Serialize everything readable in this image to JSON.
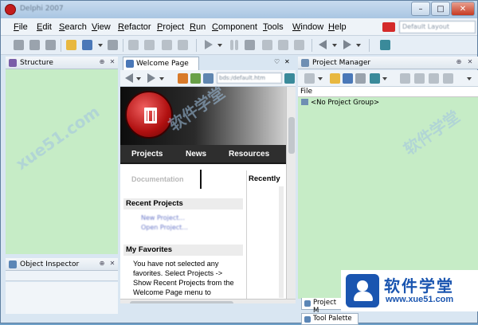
{
  "window": {
    "title": "Delphi 2007",
    "controls": {
      "minimize": "–",
      "maximize": "□",
      "close": "✕"
    }
  },
  "menu": {
    "items": [
      "File",
      "Edit",
      "Search",
      "View",
      "Refactor",
      "Project",
      "Run",
      "Component",
      "Tools",
      "Window",
      "Help"
    ],
    "desktop_combo": "Default Layout"
  },
  "toolbar": {
    "icons": [
      "new-items-icon",
      "open-icon",
      "save-icon",
      "save-all-icon",
      "open-project-icon",
      "run-icon",
      "pause-icon",
      "stop-icon",
      "step-over-icon",
      "trace-into-icon",
      "back-icon",
      "forward-icon",
      "component-icon"
    ]
  },
  "structure_panel": {
    "title": "Structure",
    "pin": "⊕",
    "close": "✕"
  },
  "object_inspector_panel": {
    "title": "Object Inspector",
    "pin": "⊕",
    "close": "✕"
  },
  "welcome": {
    "tab_label": "Welcome Page",
    "url": "bds:/default.htm",
    "nav": [
      "Projects",
      "News",
      "Resources"
    ],
    "documentation_label": "Documentation",
    "recent_projects_heading": "Recent Projects",
    "recent_links": [
      "New Project...",
      "Open Project..."
    ],
    "favorites_heading": "My Favorites",
    "favorites_text": "You have not selected any favorites. Select Projects -> Show Recent Projects from the Welcome Page menu to",
    "recently_heading": "Recently"
  },
  "project_manager": {
    "title": "Project Manager",
    "column_header": "File",
    "tree_root": "<No Project Group>",
    "pin": "⊕",
    "close": "✕"
  },
  "bottom_tabs": [
    "Project M",
    "Tool Palette"
  ],
  "watermark": {
    "brand_cn": "软件学堂",
    "brand_url": "www.xue51.com",
    "diag_text": [
      "xue51.com",
      "软件学堂",
      "软件学堂"
    ]
  },
  "colors": {
    "panel_green": "#c6ecc6",
    "hero_dark": "#0d0d0d",
    "logo_red": "#b01010",
    "brand_blue": "#1a55b0"
  }
}
